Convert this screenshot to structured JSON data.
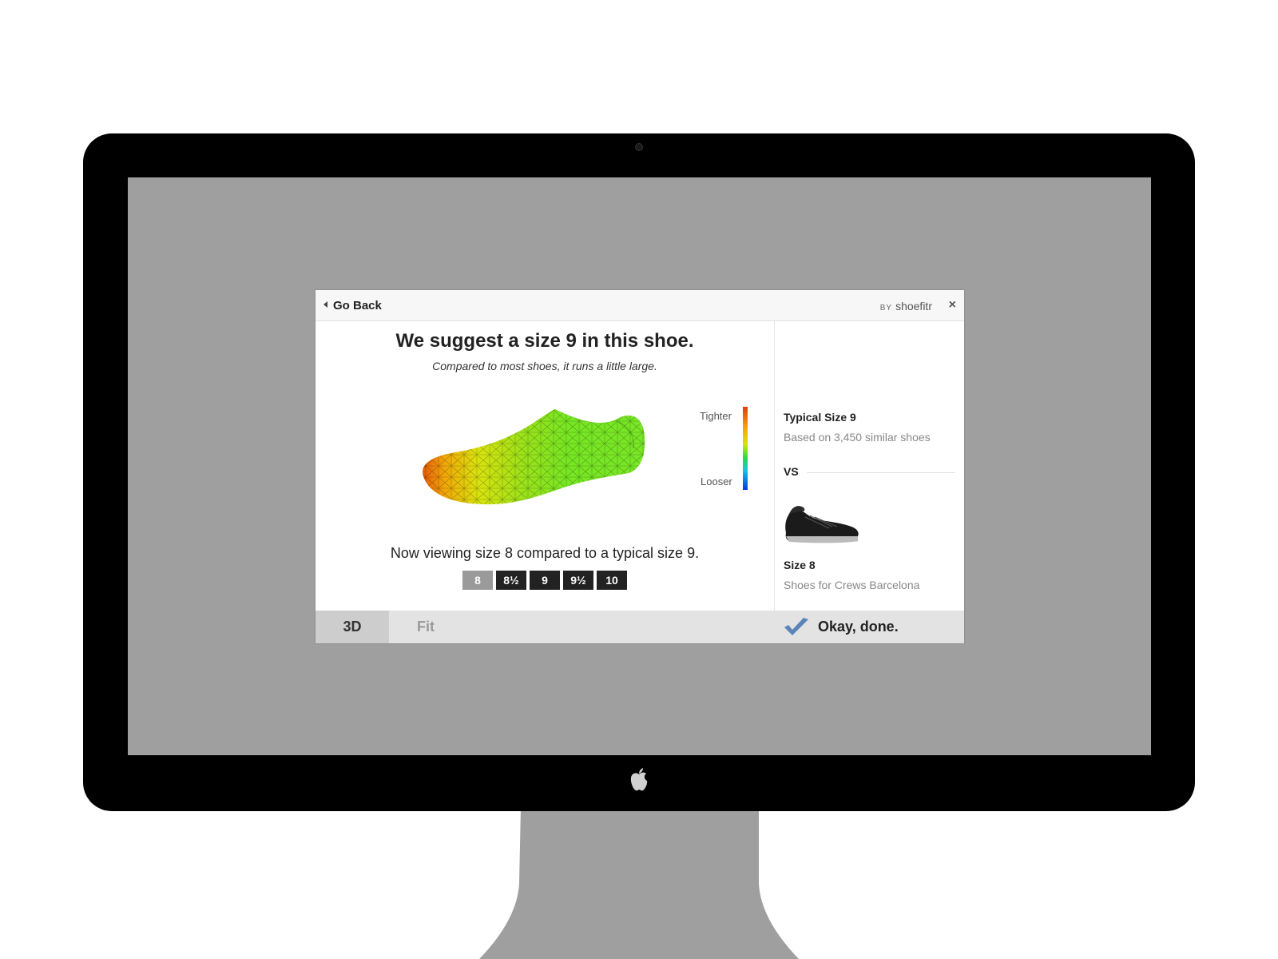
{
  "dialog": {
    "back_label": "Go Back",
    "brand_by": "BY",
    "brand_name": "shoefitr",
    "close_glyph": "×",
    "headline": "We suggest a size 9 in this shoe.",
    "subheadline": "Compared to most shoes, it runs a little large.",
    "legend": {
      "tighter": "Tighter",
      "looser": "Looser"
    },
    "viewing_text": "Now viewing size 8 compared to a typical size 9.",
    "sizes": [
      "8",
      "8½",
      "9",
      "9½",
      "10"
    ],
    "selected_size": "8",
    "comparison": {
      "typical_title": "Typical Size 9",
      "typical_sub": "Based on 3,450 similar shoes",
      "vs": "VS",
      "product_title": "Size 8",
      "product_sub": "Shoes for Crews Barcelona"
    },
    "tabs": [
      "3D",
      "Fit"
    ],
    "active_tab": "3D",
    "done_label": "Okay, done."
  },
  "colors": {
    "screen_bg": "#a09fa0",
    "bezel": "#000000",
    "stand": "#a09fa0",
    "check": "#5b84b8",
    "size_button": "#222222",
    "size_button_active": "#9a9a9a"
  },
  "icons": [
    "back-arrow-icon",
    "close-icon",
    "checkmark-icon",
    "apple-logo-icon"
  ]
}
